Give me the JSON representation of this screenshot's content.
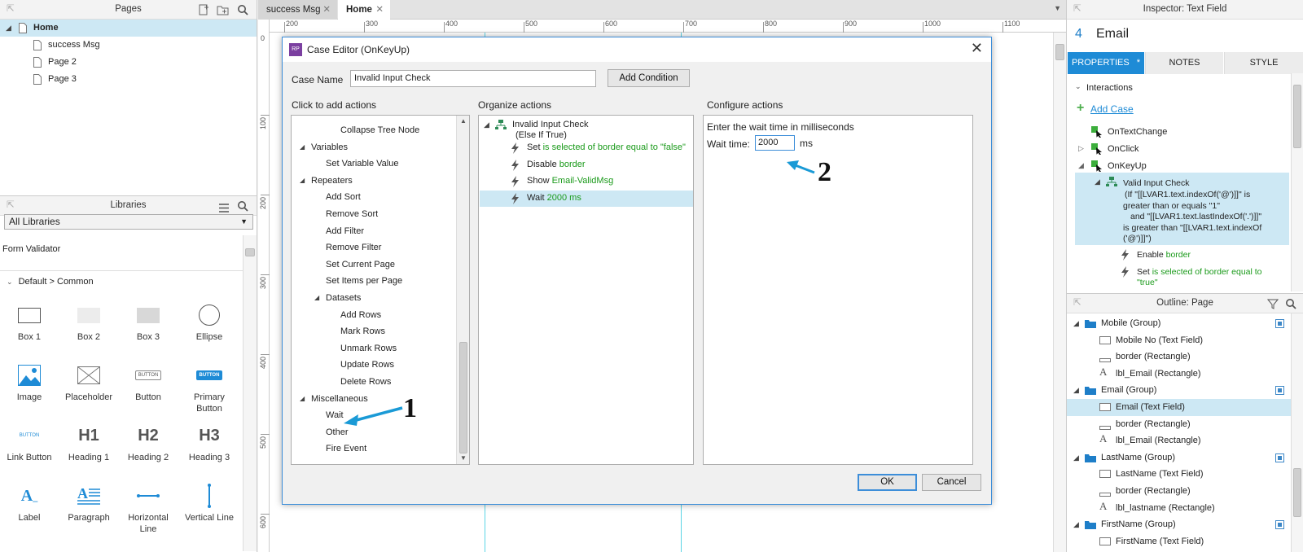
{
  "pages_panel": {
    "title": "Pages",
    "items": [
      {
        "label": "Home",
        "selected": true
      },
      {
        "label": "success Msg"
      },
      {
        "label": "Page 2"
      },
      {
        "label": "Page 3"
      }
    ]
  },
  "libraries_panel": {
    "title": "Libraries",
    "select_value": "All Libraries",
    "library_name": "Form Validator",
    "group_label": "Default > Common",
    "widgets": [
      {
        "label": "Box 1"
      },
      {
        "label": "Box 2"
      },
      {
        "label": "Box 3"
      },
      {
        "label": "Ellipse"
      },
      {
        "label": "Image"
      },
      {
        "label": "Placeholder"
      },
      {
        "label": "Button",
        "glyph": "BUTTON"
      },
      {
        "label": "Primary Button",
        "glyph": "BUTTON"
      },
      {
        "label": "Link Button",
        "glyph": "BUTTON"
      },
      {
        "label": "Heading 1",
        "glyph": "H1"
      },
      {
        "label": "Heading 2",
        "glyph": "H2"
      },
      {
        "label": "Heading 3",
        "glyph": "H3"
      },
      {
        "label": "Label"
      },
      {
        "label": "Paragraph"
      },
      {
        "label": "Horizontal Line"
      },
      {
        "label": "Vertical Line"
      }
    ]
  },
  "canvas": {
    "tabs": [
      {
        "label": "success Msg"
      },
      {
        "label": "Home",
        "active": true
      }
    ],
    "ruler_top": [
      "200",
      "300",
      "400",
      "500",
      "600",
      "700",
      "800",
      "900",
      "1000",
      "1100"
    ],
    "ruler_left": [
      "100",
      "200",
      "300",
      "400",
      "500",
      "600"
    ],
    "ruler_zero": "0"
  },
  "dialog": {
    "title": "Case Editor (OnKeyUp)",
    "case_name_label": "Case Name",
    "case_name_value": "Invalid Input Check",
    "add_condition": "Add Condition",
    "col1_title": "Click to add actions",
    "col2_title": "Organize actions",
    "col3_title": "Configure actions",
    "actions_tree": [
      {
        "label": "Collapse Tree Node",
        "level": 2
      },
      {
        "label": "Variables",
        "level": 0,
        "group": true
      },
      {
        "label": "Set Variable Value",
        "level": 1
      },
      {
        "label": "Repeaters",
        "level": 0,
        "group": true
      },
      {
        "label": "Add Sort",
        "level": 1
      },
      {
        "label": "Remove Sort",
        "level": 1
      },
      {
        "label": "Add Filter",
        "level": 1
      },
      {
        "label": "Remove Filter",
        "level": 1
      },
      {
        "label": "Set Current Page",
        "level": 1
      },
      {
        "label": "Set Items per Page",
        "level": 1
      },
      {
        "label": "Datasets",
        "level": 1,
        "group": true
      },
      {
        "label": "Add Rows",
        "level": 2
      },
      {
        "label": "Mark Rows",
        "level": 2
      },
      {
        "label": "Unmark Rows",
        "level": 2
      },
      {
        "label": "Update Rows",
        "level": 2
      },
      {
        "label": "Delete Rows",
        "level": 2
      },
      {
        "label": "Miscellaneous",
        "level": 0,
        "group": true
      },
      {
        "label": "Wait",
        "level": 1
      },
      {
        "label": "Other",
        "level": 1
      },
      {
        "label": "Fire Event",
        "level": 1
      }
    ],
    "case_header": "Invalid Input Check",
    "case_condition": "(Else If True)",
    "organized": [
      {
        "verb": "Set",
        "detail": "is selected of border equal to \"false\""
      },
      {
        "verb": "Disable",
        "detail": "border"
      },
      {
        "verb": "Show",
        "detail": "Email-ValidMsg"
      },
      {
        "verb": "Wait",
        "detail": "2000 ms",
        "selected": true
      }
    ],
    "configure_prompt": "Enter the wait time in milliseconds",
    "wait_label": "Wait time:",
    "wait_value": "2000",
    "wait_unit": "ms",
    "ok": "OK",
    "cancel": "Cancel"
  },
  "annotations": {
    "one": "1",
    "two": "2",
    "color": "#1a9ad6"
  },
  "inspector": {
    "title": "Inspector: Text Field",
    "widget_number": "4",
    "widget_name": "Email",
    "tabs": [
      {
        "label": "PROPERTIES",
        "active": true,
        "marker": "*"
      },
      {
        "label": "NOTES"
      },
      {
        "label": "STYLE"
      }
    ],
    "section": "Interactions",
    "add_case": "Add Case",
    "events": [
      {
        "label": "OnTextChange"
      },
      {
        "label": "OnClick"
      },
      {
        "label": "OnKeyUp"
      }
    ],
    "case_title": "Valid Input Check",
    "case_cond_lines": [
      "(If \"[[LVAR1.text.indexOf('@')]]\" is",
      "greater than or equals \"1\"",
      "and \"[[LVAR1.text.lastIndexOf('.')]]\"",
      "is greater than \"[[LVAR1.text.indexOf",
      "('@')]]\")"
    ],
    "case_actions": [
      {
        "verb": "Enable",
        "detail": "border"
      },
      {
        "verb": "Set",
        "detail": "is selected of border equal to"
      },
      {
        "verb": "",
        "detail": "\"true\""
      }
    ]
  },
  "outline": {
    "title": "Outline: Page",
    "rows": [
      {
        "label": "Mobile (Group)",
        "kind": "group",
        "check": true
      },
      {
        "label": "Mobile No (Text Field)",
        "kind": "field"
      },
      {
        "label": "border (Rectangle)",
        "kind": "line"
      },
      {
        "label": "lbl_Email (Rectangle)",
        "kind": "text"
      },
      {
        "label": "Email (Group)",
        "kind": "group",
        "check": true
      },
      {
        "label": "Email (Text Field)",
        "kind": "field",
        "selected": true
      },
      {
        "label": "border (Rectangle)",
        "kind": "line"
      },
      {
        "label": "lbl_Email (Rectangle)",
        "kind": "text"
      },
      {
        "label": "LastName (Group)",
        "kind": "group",
        "check": true
      },
      {
        "label": "LastName (Text Field)",
        "kind": "field"
      },
      {
        "label": "border (Rectangle)",
        "kind": "line"
      },
      {
        "label": "lbl_lastname (Rectangle)",
        "kind": "text"
      },
      {
        "label": "FirstName (Group)",
        "kind": "group",
        "check": true
      },
      {
        "label": "FirstName (Text Field)",
        "kind": "field"
      }
    ]
  }
}
